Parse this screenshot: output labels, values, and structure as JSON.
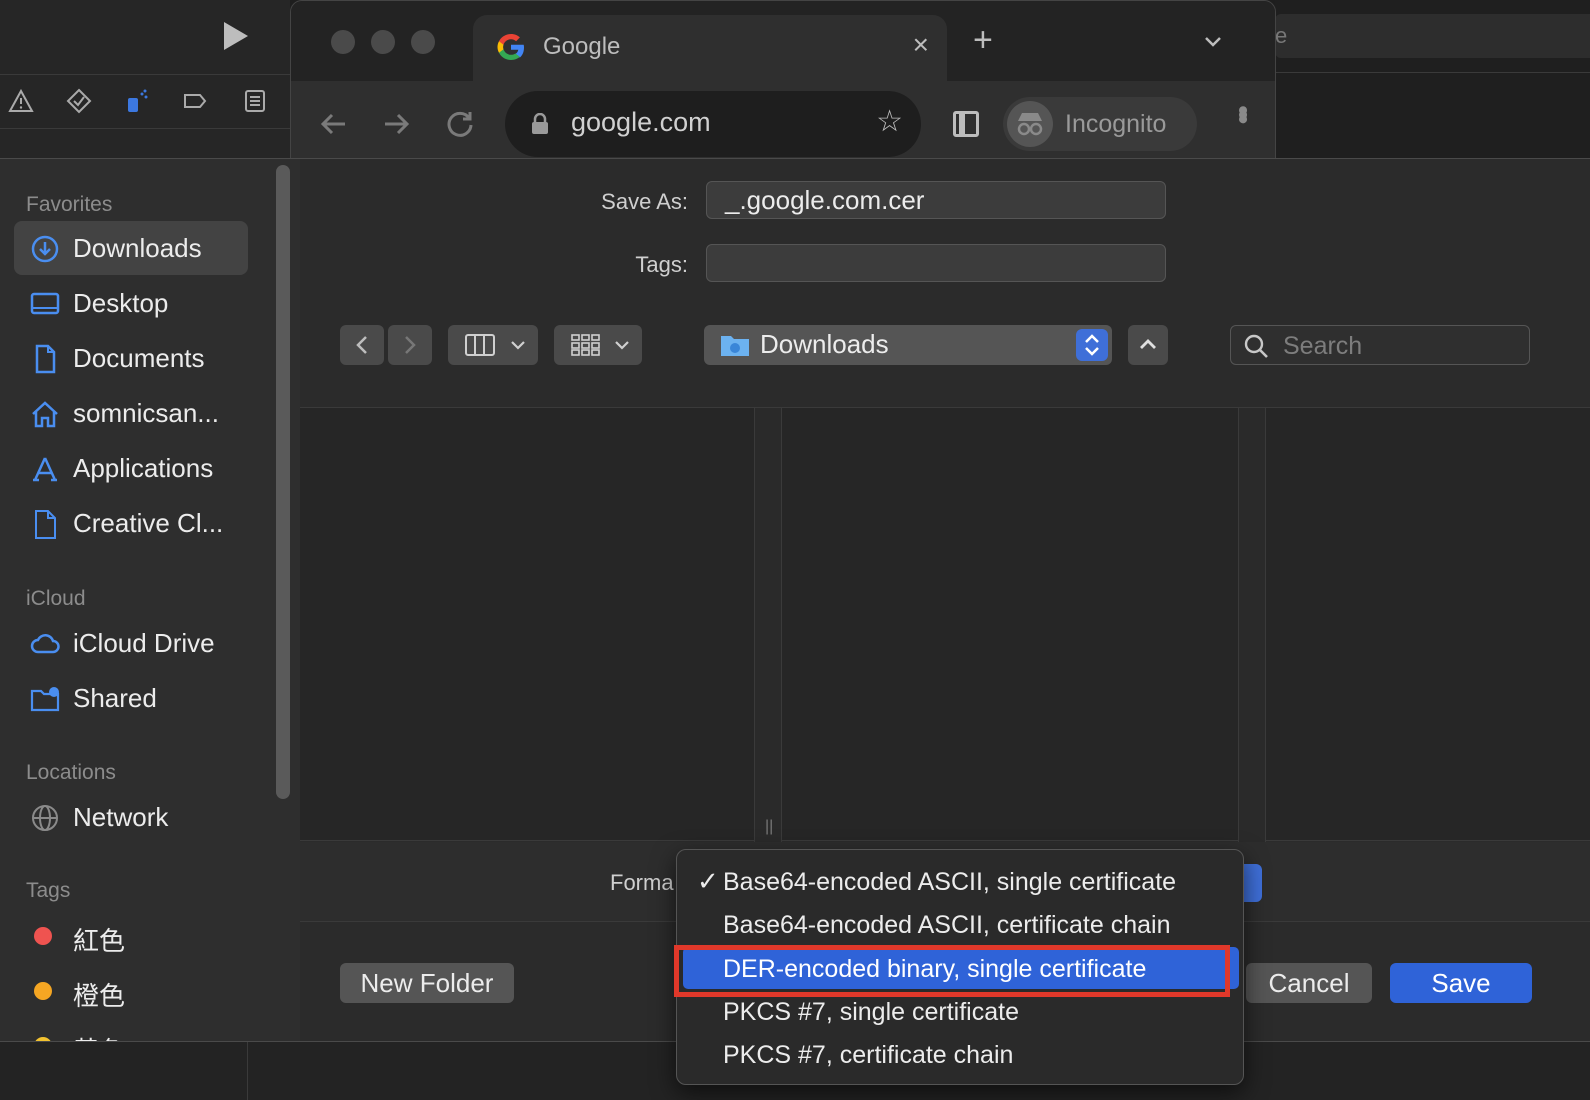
{
  "background": {
    "right_field_text": "e"
  },
  "chrome": {
    "tab_title": "Google",
    "tab_close": "×",
    "new_tab": "+",
    "url": "google.com",
    "incognito_label": "Incognito"
  },
  "dialog": {
    "save_as_label": "Save As:",
    "save_as_value": "_.google.com.cer",
    "tags_label": "Tags:",
    "tags_value": "",
    "location": "Downloads",
    "search_placeholder": "Search",
    "format_label": "Forma",
    "new_folder": "New Folder",
    "cancel": "Cancel",
    "save": "Save"
  },
  "sidebar": {
    "favorites_header": "Favorites",
    "favorites": [
      {
        "label": "Downloads",
        "icon": "downloads-icon",
        "selected": true
      },
      {
        "label": "Desktop",
        "icon": "desktop-icon"
      },
      {
        "label": "Documents",
        "icon": "documents-icon"
      },
      {
        "label": "somnicsan...",
        "icon": "home-icon"
      },
      {
        "label": "Applications",
        "icon": "applications-icon"
      },
      {
        "label": "Creative Cl...",
        "icon": "document-icon"
      }
    ],
    "icloud_header": "iCloud",
    "icloud": [
      {
        "label": "iCloud Drive",
        "icon": "cloud-icon"
      },
      {
        "label": "Shared",
        "icon": "shared-folder-icon"
      }
    ],
    "locations_header": "Locations",
    "locations": [
      {
        "label": "Network",
        "icon": "globe-icon"
      }
    ],
    "tags_header": "Tags",
    "tags": [
      {
        "label": "紅色",
        "color": "#ef5350"
      },
      {
        "label": "橙色",
        "color": "#f5a623"
      },
      {
        "label": "黃色",
        "color": "#f2c230"
      }
    ]
  },
  "format_menu": {
    "items": [
      {
        "label": "Base64-encoded ASCII, single certificate",
        "checked": true,
        "check_mark": "✓"
      },
      {
        "label": "Base64-encoded ASCII, certificate chain"
      },
      {
        "label": "DER-encoded binary, single certificate",
        "highlighted": true
      },
      {
        "label": "PKCS #7, single certificate"
      },
      {
        "label": "PKCS #7, certificate chain"
      }
    ]
  },
  "colors": {
    "accent_blue": "#2f63d8",
    "annotation_red": "#e0382a",
    "sidebar_icon_blue": "#4a8ef0"
  }
}
